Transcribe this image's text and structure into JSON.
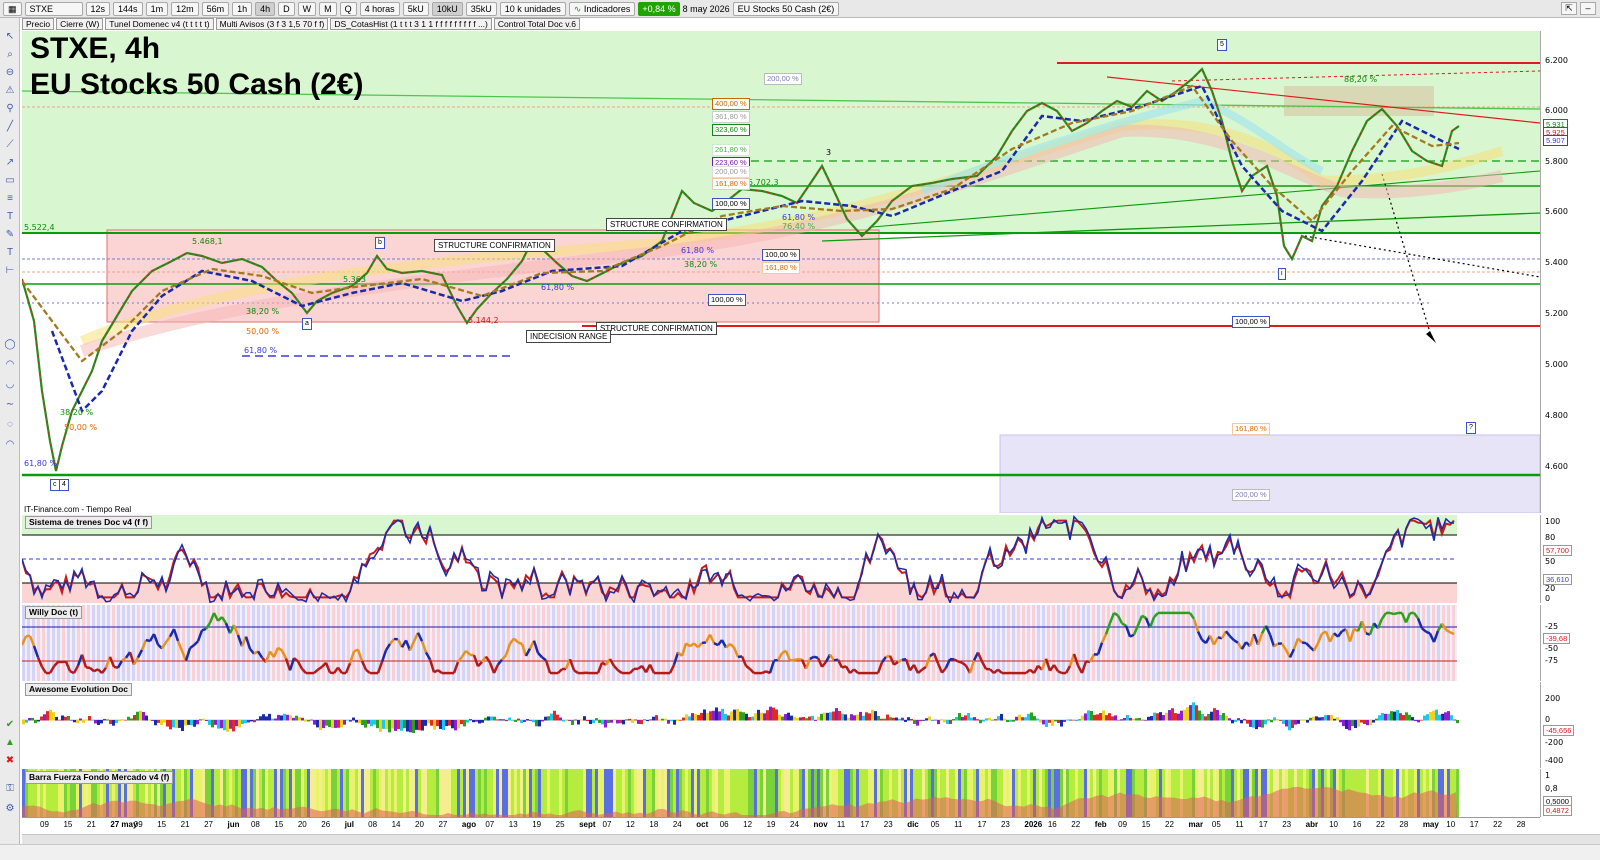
{
  "toolbar": {
    "symbol": "STXE",
    "timeframes": [
      "12s",
      "144s",
      "1m",
      "12m",
      "56m",
      "1h",
      "4h",
      "D",
      "W",
      "M",
      "Q"
    ],
    "interval_select": "4 horas",
    "volume_steps": [
      "5kU",
      "10kU",
      "35kU"
    ],
    "units_select": "10 k unidades",
    "indicators_label": "Indicadores",
    "change_badge": "+0,84 %",
    "date": "8 may 2026",
    "instrument": "EU Stocks 50 Cash (2€)"
  },
  "overlays": [
    "Precio",
    "Cierre (W)",
    "Tunel Domenec v4 (t t t t t)",
    "Multi Avisos (3 f 3 1,5 70 f f)",
    "DS_CotasHist (1 t t t 3 1 1 f f f f f f f f f ...)",
    "Control Total Doc v.6"
  ],
  "chart": {
    "title_line1": "STXE, 4h",
    "title_line2": "EU Stocks 50 Cash (2€)",
    "credit": "IT-Finance.com - Tiempo Real",
    "price_ticks": [
      "6.200",
      "6.000",
      "5.800",
      "5.600",
      "5.400",
      "5.200",
      "5.000",
      "4.800",
      "4.600"
    ],
    "price_labels": [
      "5.931",
      "5.925",
      "5.907"
    ],
    "annotations": {
      "level_5522": "5.522,4",
      "level_5468": "5.468,1",
      "level_5702": "5.702,3",
      "level_5363": "5.363",
      "level_5144": "5.144,2",
      "struct1": "STRUCTURE CONFIRMATION",
      "struct2": "STRUCTURE CONFIRMATION",
      "struct3": "STRUCTURE CONFIRMATION",
      "indecision": "INDECISION RANGE",
      "fib_200_top": "200,00 %",
      "fib_400": "400,00 %",
      "fib_361": "361,80 %",
      "fib_323": "323,60 %",
      "fib_261": "261,80 %",
      "fib_223": "223,60 %",
      "fib_200b": "200,00 %",
      "fib_161": "161,80 %",
      "fib_100a": "100,00 %",
      "fib_100b": "100,00 %",
      "fib_161b": "161,80 %",
      "fib_100c": "100,00 %",
      "fib_100d": "100,00 %",
      "fib_618a": "61,80 %",
      "fib_618b": "61,80 %",
      "fib_618c": "61,80 %",
      "fib_618d": "61,80 %",
      "fib_618e": "61,80 %",
      "fib_382a": "38,20 %",
      "fib_382b": "38,20 %",
      "fib_382c": "38,20 %",
      "fib_382d": "38,20 %",
      "fib_500a": "50,00 %",
      "fib_500b": "50,00 %",
      "fib_764": "76,40 %",
      "fib_1618low": "161,80 %",
      "fib_200low": "200,00 %",
      "fib_882": "88,20 %",
      "wave_b": "b",
      "wave_a": "a",
      "wave_3": "3",
      "wave_5": "5",
      "wave_i": "i",
      "wave_c4": "c",
      "wave_4": "4",
      "wave_q": "?"
    }
  },
  "panes": {
    "trenes": {
      "title": "Sistema de trenes Doc v4 (f f)",
      "ticks": [
        "100",
        "80",
        "50",
        "20",
        "0"
      ],
      "values": [
        "57,700",
        "36,610"
      ]
    },
    "willy": {
      "title": "Willy Doc (t)",
      "ticks": [
        "-25",
        "-50",
        "-75"
      ],
      "values": [
        "-39,68"
      ]
    },
    "awesome": {
      "title": "Awesome Evolution Doc",
      "ticks": [
        "200",
        "0",
        "-200",
        "-400"
      ],
      "values": [
        "-45,656"
      ]
    },
    "barra": {
      "title": "Barra Fuerza Fondo Mercado v4 (f)",
      "ticks": [
        "1",
        "0,8",
        "0,5000",
        "0,4872"
      ]
    }
  },
  "time_axis": [
    "09",
    "15",
    "21",
    "27 may",
    "09",
    "15",
    "21",
    "27",
    "jun",
    "08",
    "15",
    "20",
    "26",
    "jul",
    "08",
    "14",
    "20",
    "27",
    "ago",
    "07",
    "13",
    "19",
    "25",
    "sept",
    "07",
    "12",
    "18",
    "24",
    "oct",
    "06",
    "12",
    "19",
    "24",
    "nov",
    "11",
    "17",
    "23",
    "dic",
    "05",
    "11",
    "17",
    "23",
    "2026",
    "16",
    "22",
    "feb",
    "09",
    "15",
    "22",
    "mar",
    "05",
    "11",
    "17",
    "23",
    "abr",
    "10",
    "16",
    "22",
    "28",
    "may",
    "10",
    "17",
    "22",
    "28"
  ]
}
